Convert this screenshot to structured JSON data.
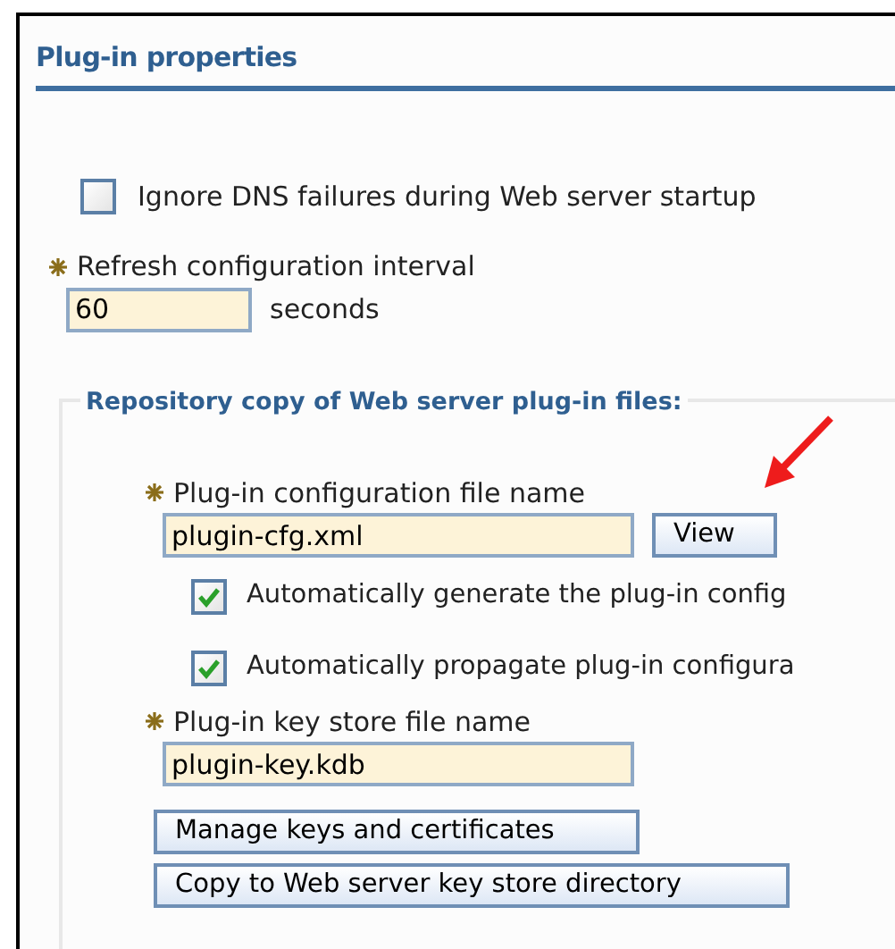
{
  "section_title": "Plug-in properties",
  "ignore_dns": {
    "label": "Ignore DNS failures during Web server startup",
    "checked": false
  },
  "refresh_interval": {
    "label": "Refresh configuration interval",
    "required": true,
    "value": "60",
    "unit": "seconds"
  },
  "repository": {
    "legend": "Repository copy of Web server plug-in files:",
    "config_file": {
      "label": "Plug-in configuration file name",
      "required": true,
      "value": "plugin-cfg.xml",
      "button": "View"
    },
    "options": [
      {
        "label": "Automatically generate the plug-in config",
        "checked": true
      },
      {
        "label": "Automatically propagate plug-in configura",
        "checked": true
      }
    ],
    "key_store": {
      "label": "Plug-in key store file name",
      "required": true,
      "value": "plugin-key.kdb"
    },
    "buttons": [
      "Manage keys and certificates",
      "Copy to Web server key store directory"
    ]
  }
}
